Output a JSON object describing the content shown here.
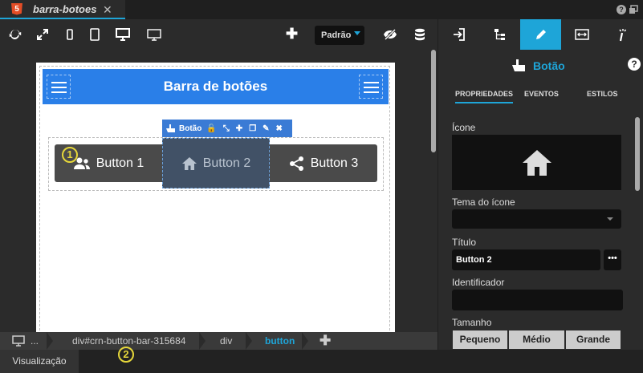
{
  "tab": {
    "title": "barra-botoes",
    "html5_glyph": "5",
    "close_glyph": "✕"
  },
  "window_help_glyph": "?",
  "toolbar": {
    "add_glyph": "✚",
    "theme_select": "Padrão"
  },
  "app": {
    "header_title": "Barra de botões",
    "buttons": [
      {
        "label": "Button 1",
        "icon": "people-icon"
      },
      {
        "label": "Button 2",
        "icon": "home-icon"
      },
      {
        "label": "Button 3",
        "icon": "share-icon"
      }
    ],
    "float_toolbar": {
      "label": "Botão",
      "icons": [
        "🔓",
        "⤡",
        "✚",
        "❐",
        "✎",
        "✖"
      ]
    }
  },
  "badges": {
    "first": "1",
    "second": "2"
  },
  "breadcrumb": {
    "items": [
      "...",
      "div#crn-button-bar-315684",
      "div",
      "button"
    ],
    "add_glyph": "✚"
  },
  "status": {
    "tab_label": "Visualização"
  },
  "panel": {
    "title": "Botão",
    "help_glyph": "?",
    "tabs": [
      "PROPRIEDADES",
      "EVENTOS",
      "ESTILOS"
    ],
    "fields": {
      "icon_label": "Ícone",
      "icon_theme_label": "Tema do ícone",
      "title_label": "Título",
      "title_value": "Button 2",
      "more_glyph": "•••",
      "identifier_label": "Identificador",
      "size_label": "Tamanho"
    },
    "size_options": [
      "Pequeno",
      "Médio",
      "Grande"
    ]
  },
  "colors": {
    "accent": "#1ea5d8",
    "appbar": "#2a7fe8",
    "badge": "#e6d73a"
  }
}
